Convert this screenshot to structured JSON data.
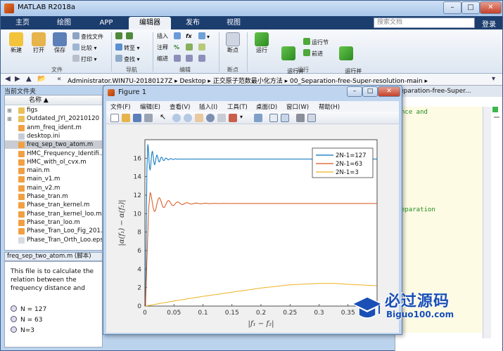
{
  "window": {
    "title": "MATLAB R2018a"
  },
  "tabs": [
    "主页",
    "绘图",
    "APP",
    "编辑器",
    "发布",
    "视图"
  ],
  "search": {
    "placeholder": "搜索文档"
  },
  "login_label": "登录",
  "ribbon": {
    "new_label": "新建",
    "open_label": "打开",
    "save_label": "保存",
    "find_files_label": "查找文件",
    "compare_label": "比较",
    "print_label": "打印",
    "goto_label": "转至",
    "find_label": "查找",
    "insert_label": "插入",
    "comment_label": "注释",
    "indent_label": "缩进",
    "breakpoints_label": "断点",
    "run_label": "运行",
    "run_advance_label": "运行并\n前进",
    "run_section_label": "运行节",
    "advance_label": "前进",
    "run_time_label": "运行并\n计时",
    "groups": [
      "文件",
      "导航",
      "编辑",
      "断点",
      "运行"
    ]
  },
  "address": {
    "path": "Administrator.WIN7U-20180127Z  ▸  Desktop  ▸  正交原子范数最小化方法  ▸  00_Separation-free-Super-resolution-main  ▸"
  },
  "file_browser": {
    "header": "当前文件夹",
    "column": "名称 ▲",
    "items": [
      {
        "name": "figs",
        "type": "folder"
      },
      {
        "name": "Outdated_JYI_20210120",
        "type": "folder"
      },
      {
        "name": "anm_freq_ident.m",
        "type": "m"
      },
      {
        "name": "desktop.ini",
        "type": "ini"
      },
      {
        "name": "freq_sep_two_atom.m",
        "type": "m"
      },
      {
        "name": "HMC_Frequency_Identifi...",
        "type": "m"
      },
      {
        "name": "HMC_with_ol_cvx.m",
        "type": "m"
      },
      {
        "name": "main.m",
        "type": "m"
      },
      {
        "name": "main_v1.m",
        "type": "m"
      },
      {
        "name": "main_v2.m",
        "type": "m"
      },
      {
        "name": "Phase_tran.m",
        "type": "m"
      },
      {
        "name": "Phase_tran_kernel.m",
        "type": "m"
      },
      {
        "name": "Phase_tran_kernel_loo.m",
        "type": "m"
      },
      {
        "name": "Phase_tran_loo.m",
        "type": "m"
      },
      {
        "name": "Phase_Tran_Loo_Fig_201...",
        "type": "m"
      },
      {
        "name": "Phase_Tran_Orth_Loo.eps",
        "type": "eps"
      }
    ],
    "selected_index": 4
  },
  "details": {
    "header": "freq_sep_two_atom.m  (脚本)",
    "description": "This file is to calculate the relation between the frequency distance and",
    "items": [
      "N = 127",
      "N = 63",
      "N=3"
    ]
  },
  "editor": {
    "tab_label": "eparation-free-Super...",
    "line1": "nce and",
    "line2": "eparation"
  },
  "figure": {
    "title": "Figure 1",
    "menus": [
      "文件(F)",
      "编辑(E)",
      "查看(V)",
      "插入(I)",
      "工具(T)",
      "桌面(D)",
      "窗口(W)",
      "帮助(H)"
    ]
  },
  "chart_data": {
    "type": "line",
    "xlabel": "|f₁ − f₂|",
    "ylabel": "|α(f₁) − α(f₂)|",
    "xlim": [
      0,
      0.4
    ],
    "ylim": [
      0,
      18
    ],
    "xticks": [
      0,
      0.05,
      0.1,
      0.15,
      0.2,
      0.25,
      0.3,
      0.35
    ],
    "xtick_labels": [
      "0",
      "0.05",
      "0.1",
      "0.15",
      "0.2",
      "0.25",
      "0.3",
      "0.35"
    ],
    "yticks": [
      0,
      2,
      4,
      6,
      8,
      10,
      12,
      14,
      16
    ],
    "grid": false,
    "legend_position": "top-right",
    "series": [
      {
        "name": "2N-1=127",
        "color": "#0072bd",
        "kind": "oscillation",
        "start": [
          0.001,
          0
        ],
        "peak": [
          0.005,
          17.6
        ],
        "steady": 15.9,
        "osc_amp": 1.6,
        "period": 0.0079,
        "decay": 0.012
      },
      {
        "name": "2N-1=63",
        "color": "#d95319",
        "kind": "oscillation",
        "start": [
          0.001,
          0
        ],
        "peak": [
          0.009,
          12.3
        ],
        "steady": 11.1,
        "osc_amp": 1.2,
        "period": 0.0159,
        "decay": 0.024
      },
      {
        "name": "2N-1=3",
        "color": "#edb120",
        "kind": "smooth",
        "points": [
          [
            0.001,
            0
          ],
          [
            0.05,
            0.55
          ],
          [
            0.1,
            1.05
          ],
          [
            0.15,
            1.5
          ],
          [
            0.2,
            1.95
          ],
          [
            0.25,
            2.3
          ],
          [
            0.3,
            2.45
          ],
          [
            0.33,
            2.45
          ],
          [
            0.35,
            2.35
          ],
          [
            0.4,
            2.2
          ]
        ]
      }
    ]
  },
  "watermark": {
    "text": "必过源码",
    "url": "Biguo100.com"
  }
}
